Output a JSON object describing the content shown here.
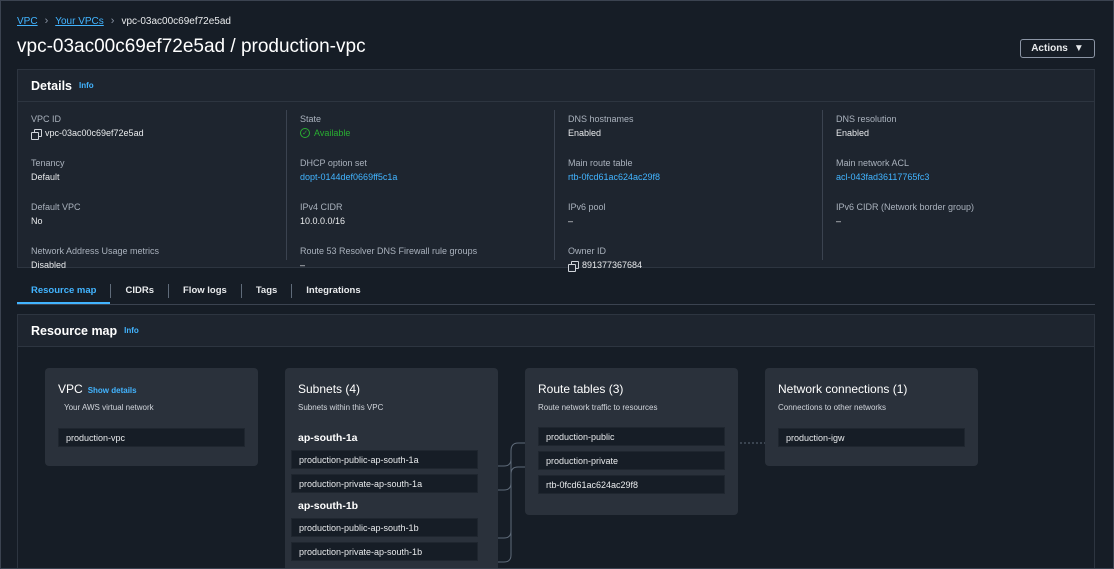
{
  "breadcrumb": {
    "vpc": "VPC",
    "your_vpcs": "Your VPCs",
    "current": "vpc-03ac00c69ef72e5ad"
  },
  "page_title": "vpc-03ac00c69ef72e5ad / production-vpc",
  "actions_label": "Actions",
  "details": {
    "title": "Details",
    "info": "Info",
    "columns": [
      [
        {
          "label": "VPC ID",
          "value": "vpc-03ac00c69ef72e5ad",
          "copy": true
        },
        {
          "label": "Tenancy",
          "value": "Default"
        },
        {
          "label": "Default VPC",
          "value": "No"
        },
        {
          "label": "Network Address Usage metrics",
          "value": "Disabled"
        }
      ],
      [
        {
          "label": "State",
          "value": "Available",
          "status": true
        },
        {
          "label": "DHCP option set",
          "value": "dopt-0144def0669ff5c1a",
          "link": true
        },
        {
          "label": "IPv4 CIDR",
          "value": "10.0.0.0/16"
        },
        {
          "label": "Route 53 Resolver DNS Firewall rule groups",
          "value": "–"
        }
      ],
      [
        {
          "label": "DNS hostnames",
          "value": "Enabled"
        },
        {
          "label": "Main route table",
          "value": "rtb-0fcd61ac624ac29f8",
          "link": true
        },
        {
          "label": "IPv6 pool",
          "value": "–"
        },
        {
          "label": "Owner ID",
          "value": "891377367684",
          "copy": true
        }
      ],
      [
        {
          "label": "DNS resolution",
          "value": "Enabled"
        },
        {
          "label": "Main network ACL",
          "value": "acl-043fad36117765fc3",
          "link": true
        },
        {
          "label": "IPv6 CIDR (Network border group)",
          "value": "–"
        }
      ]
    ]
  },
  "tabs": [
    "Resource map",
    "CIDRs",
    "Flow logs",
    "Tags",
    "Integrations"
  ],
  "resource_map": {
    "title": "Resource map",
    "info": "Info",
    "vpc_card": {
      "title": "VPC",
      "show_details": "Show details",
      "subtitle": "Your AWS virtual network",
      "items": [
        "production-vpc"
      ]
    },
    "subnets_card": {
      "title": "Subnets (4)",
      "subtitle": "Subnets within this VPC",
      "groups": [
        {
          "az": "ap-south-1a",
          "items": [
            "production-public-ap-south-1a",
            "production-private-ap-south-1a"
          ]
        },
        {
          "az": "ap-south-1b",
          "items": [
            "production-public-ap-south-1b",
            "production-private-ap-south-1b"
          ]
        }
      ]
    },
    "route_tables_card": {
      "title": "Route tables (3)",
      "subtitle": "Route network traffic to resources",
      "items": [
        "production-public",
        "production-private",
        "rtb-0fcd61ac624ac29f8"
      ]
    },
    "network_card": {
      "title": "Network connections (1)",
      "subtitle": "Connections to other networks",
      "items": [
        "production-igw"
      ]
    }
  },
  "colors": {
    "link": "#42b4ff",
    "status_available": "#29ad32",
    "background": "#161d26",
    "panel": "#1e252f"
  }
}
